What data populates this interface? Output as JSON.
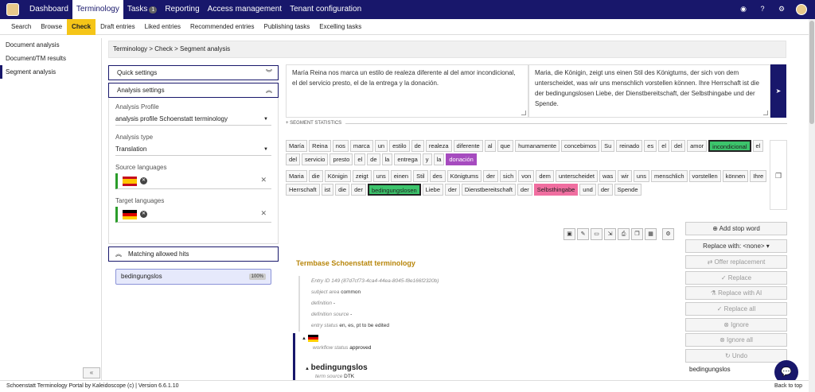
{
  "topnav": {
    "items": [
      {
        "label": "Dashboard",
        "active": false
      },
      {
        "label": "Terminology",
        "active": true
      },
      {
        "label": "Tasks",
        "active": false
      },
      {
        "label": "Reporting",
        "active": false
      },
      {
        "label": "Access management",
        "active": false
      },
      {
        "label": "Tenant configuration",
        "active": false
      }
    ],
    "tasks_badge": "1",
    "brand_color": "#18176b"
  },
  "subnav": {
    "items": [
      "Search",
      "Browse",
      "Check",
      "Draft entries",
      "Liked entries",
      "Recommended entries",
      "Publishing tasks",
      "Excelling tasks"
    ],
    "active": "Check",
    "active_color": "#f5c518"
  },
  "leftnav": {
    "items": [
      "Document analysis",
      "Document/TM results",
      "Segment analysis"
    ],
    "active": "Segment analysis",
    "collapse_label": "«"
  },
  "breadcrumb": "Terminology > Check > Segment analysis",
  "panels": {
    "quick_settings": "Quick settings",
    "analysis_settings": "Analysis settings",
    "matching_hits": "Matching allowed hits"
  },
  "settings": {
    "profile_label": "Analysis Profile",
    "profile_value": "analysis profile Schoenstatt terminology",
    "type_label": "Analysis type",
    "type_value": "Translation",
    "source_label": "Source languages",
    "target_label": "Target languages"
  },
  "hit": {
    "label": "bedingungslos",
    "percent": "100%"
  },
  "source_text": "María Reina nos marca un estilo de realeza diferente al del amor incondicional, el del servicio presto, el de la entrega y la donación.",
  "target_text": "Maria, die Königin, zeigt uns einen Stil des Königtums, der sich von dem unterscheidet, was wir uns menschlich vorstellen können. Ihre Herrschaft ist die der bedingungslosen Liebe, der Dienstbereitschaft, der Selbsthingabe und der Spende.",
  "segment_stats_label": "SEGMENT STATISTICS",
  "source_tokens": [
    {
      "t": "María",
      "h": ""
    },
    {
      "t": "Reina",
      "h": ""
    },
    {
      "t": "nos",
      "h": ""
    },
    {
      "t": "marca",
      "h": ""
    },
    {
      "t": "un",
      "h": ""
    },
    {
      "t": "estilo",
      "h": ""
    },
    {
      "t": "de",
      "h": ""
    },
    {
      "t": "realeza",
      "h": ""
    },
    {
      "t": "diferente",
      "h": ""
    },
    {
      "t": "al",
      "h": ""
    },
    {
      "t": "que",
      "h": ""
    },
    {
      "t": "humanamente",
      "h": ""
    },
    {
      "t": "concebimos",
      "h": ""
    },
    {
      "t": "Su",
      "h": ""
    },
    {
      "t": "reinado",
      "h": ""
    },
    {
      "t": "es",
      "h": ""
    },
    {
      "t": "el",
      "h": ""
    },
    {
      "t": "del",
      "h": ""
    },
    {
      "t": "amor",
      "h": ""
    },
    {
      "t": "incondicional",
      "h": "green"
    },
    {
      "t": "el",
      "h": ""
    },
    {
      "t": "del",
      "h": ""
    },
    {
      "t": "servicio",
      "h": ""
    },
    {
      "t": "presto",
      "h": ""
    },
    {
      "t": "el",
      "h": ""
    },
    {
      "t": "de",
      "h": ""
    },
    {
      "t": "la",
      "h": ""
    },
    {
      "t": "entrega",
      "h": ""
    },
    {
      "t": "y",
      "h": ""
    },
    {
      "t": "la",
      "h": ""
    },
    {
      "t": "donación",
      "h": "purple"
    }
  ],
  "target_tokens": [
    {
      "t": "Maria",
      "h": ""
    },
    {
      "t": "die",
      "h": ""
    },
    {
      "t": "Königin",
      "h": ""
    },
    {
      "t": "zeigt",
      "h": ""
    },
    {
      "t": "uns",
      "h": ""
    },
    {
      "t": "einen",
      "h": ""
    },
    {
      "t": "Stil",
      "h": ""
    },
    {
      "t": "des",
      "h": ""
    },
    {
      "t": "Königtums",
      "h": ""
    },
    {
      "t": "der",
      "h": ""
    },
    {
      "t": "sich",
      "h": ""
    },
    {
      "t": "von",
      "h": ""
    },
    {
      "t": "dem",
      "h": ""
    },
    {
      "t": "unterscheidet",
      "h": ""
    },
    {
      "t": "was",
      "h": ""
    },
    {
      "t": "wir",
      "h": ""
    },
    {
      "t": "uns",
      "h": ""
    },
    {
      "t": "menschlich",
      "h": ""
    },
    {
      "t": "vorstellen",
      "h": ""
    },
    {
      "t": "können",
      "h": ""
    },
    {
      "t": "Ihre",
      "h": ""
    },
    {
      "t": "Herrschaft",
      "h": ""
    },
    {
      "t": "ist",
      "h": ""
    },
    {
      "t": "die",
      "h": ""
    },
    {
      "t": "der",
      "h": ""
    },
    {
      "t": "bedingungslosen",
      "h": "green"
    },
    {
      "t": "Liebe",
      "h": ""
    },
    {
      "t": "der",
      "h": ""
    },
    {
      "t": "Dienstbereitschaft",
      "h": ""
    },
    {
      "t": "der",
      "h": ""
    },
    {
      "t": "Selbsthingabe",
      "h": "pink"
    },
    {
      "t": "und",
      "h": ""
    },
    {
      "t": "der",
      "h": ""
    },
    {
      "t": "Spende",
      "h": ""
    }
  ],
  "actions": {
    "add_stop_word": "Add stop word",
    "replace_with": "Replace with: <none>",
    "offer_replacement": "Offer replacement",
    "replace": "Replace",
    "replace_ai": "Replace with AI",
    "replace_all": "Replace all",
    "ignore": "Ignore",
    "ignore_all": "Ignore all",
    "undo": "Undo"
  },
  "termbase": {
    "title": "Termbase Schoenstatt terminology",
    "entry_id": "Entry ID 149 (87d7cf73-4ca4-44ea-8045-f8e166f2320b)",
    "subject_area_k": "subject area",
    "subject_area_v": "common",
    "definition_k": "definition",
    "definition_v": "-",
    "def_source_k": "definition source",
    "def_source_v": "-",
    "entry_status_k": "entry status",
    "entry_status_v": "en, es, pt to be edited",
    "workflow_k": "workflow status",
    "workflow_v": "approved",
    "term": "bedingungslos",
    "term_source_k": "term source",
    "term_source_v": "DTK"
  },
  "search_value": "bedingungslos",
  "footer": "Schoenstatt Terminology Portal by Kaleidoscope (c) | Version 6.6.1.10",
  "back_to_top": "Back to top"
}
